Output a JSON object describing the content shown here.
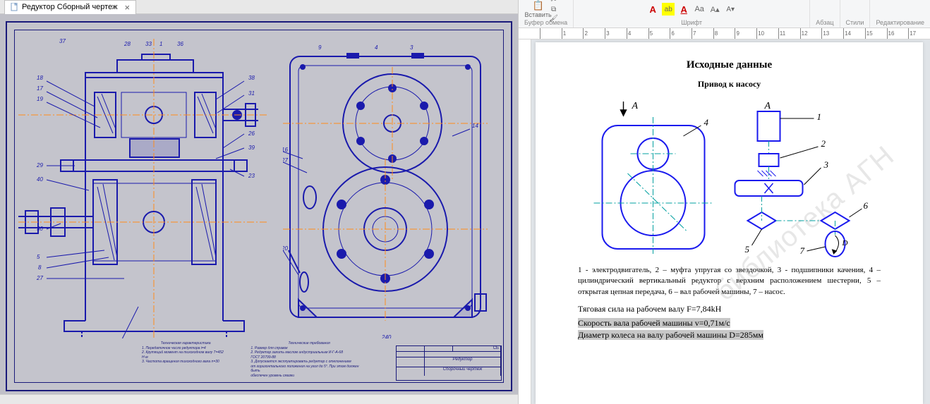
{
  "tab": {
    "title": "Редуктор Сборный чертеж"
  },
  "title_block": {
    "top_right": "СБ",
    "name1": "Редуктор",
    "name2": "Сборочный чертеж"
  },
  "notes": {
    "left_title": "Техническая характеристика",
    "left_l1": "1. Передаточное число редуктора i=4",
    "left_l2": "2. Крутящий момент на тихоходном валу Т=452 Н·м",
    "left_l3": "3. Частота вращения тихоходного вала n=30",
    "right_title": "Технические требования",
    "right_l1": "1. Размер для справок",
    "right_l2": "2. Редуктор залить маслом индустриальным И-Г-А-68",
    "right_l3": "ГОСТ 20799-88",
    "right_l4": "3. Допускается эксплуатировать редуктор с отклонением",
    "right_l5": "от горизонтального положения на угол до 5°. При этом должен быть",
    "right_l6": "обеспечен уровень смазки"
  },
  "ribbon": {
    "paste": "Вставить",
    "clipboard": "Буфер обмена",
    "font": "Шрифт",
    "paragraph": "Абзац",
    "styles": "Стили",
    "editing": "Редактирование"
  },
  "ruler_cm": [
    "",
    "1",
    "2",
    "3",
    "4",
    "5",
    "6",
    "7",
    "8",
    "9",
    "10",
    "11",
    "12",
    "13",
    "14",
    "15",
    "16",
    "17"
  ],
  "doc": {
    "h1": "Исходные данные",
    "h2": "Привод к насосу",
    "arrow_label_a1": "A",
    "arrow_label_a2": "A",
    "scheme_nums": {
      "n1": "1",
      "n2": "2",
      "n3": "3",
      "n4": "4",
      "n5": "5",
      "n6": "6",
      "n7": "7"
    },
    "legend": "1 - электродвигатель, 2 – муфта упругая со звездочкой, 3 - подшипники качения, 4 – цилиндрический вертикальный редуктор с верхним расположением шестерни, 5 – открытая цепная передача, 6 – вал рабочей машины, 7 – насос.",
    "p1": "Тяговая сила на рабочем валу F=7,84kH",
    "p2": "Скорость вала рабочей машины v=0,71м/с",
    "p3": "Диаметр колеса на валу рабочей машины D=285мм",
    "watermark": "библиотека АГН"
  }
}
